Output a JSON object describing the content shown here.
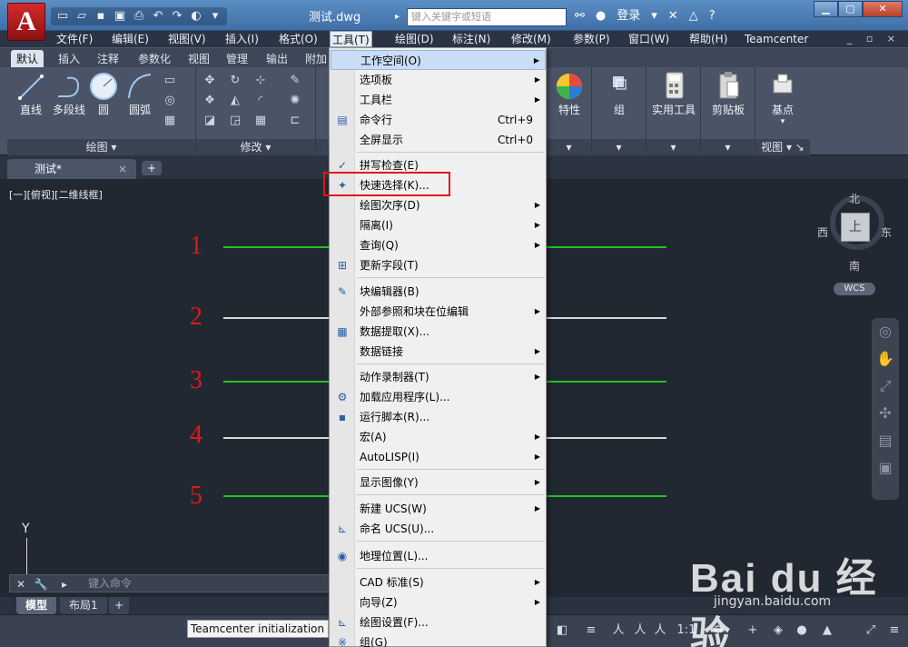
{
  "titlebar": {
    "app_logo": "A",
    "doc_title": "测试.dwg",
    "search_placeholder": "键入关键字或短语",
    "login": "登录",
    "help": "?"
  },
  "menubar": {
    "items": [
      "文件(F)",
      "编辑(E)",
      "视图(V)",
      "插入(I)",
      "格式(O)",
      "工具(T)",
      "绘图(D)",
      "标注(N)",
      "修改(M)",
      "参数(P)",
      "窗口(W)",
      "帮助(H)",
      "Teamcenter"
    ],
    "active": "工具(T)"
  },
  "ribbon": {
    "tabs": [
      "默认",
      "插入",
      "注释",
      "参数化",
      "视图",
      "管理",
      "输出",
      "附加"
    ],
    "groups": {
      "draw": {
        "title": "绘图",
        "tools": [
          "直线",
          "多段线",
          "圆",
          "圆弧"
        ]
      },
      "modify": {
        "title": "修改"
      },
      "properties": {
        "tool": "特性"
      },
      "group": {
        "tool": "组"
      },
      "utilities": {
        "tool": "实用工具"
      },
      "clipboard": {
        "tool": "剪贴板"
      },
      "view": {
        "title": "视图",
        "tool": "基点"
      }
    }
  },
  "filetab": {
    "label": "测试*",
    "close": "×",
    "add": "+"
  },
  "canvas": {
    "view_label": "[一][俯视][二维线框]",
    "line_numbers": [
      "1",
      "2",
      "3",
      "4",
      "5"
    ],
    "line_colors": [
      "#22c322",
      "#d8d8d8",
      "#22c322",
      "#d8d8d8",
      "#22c322"
    ],
    "compass": {
      "north": "北",
      "south": "南",
      "east": "东",
      "west": "西",
      "cube_face": "上"
    },
    "wcs": "WCS",
    "ucs_axis": "Y"
  },
  "command": {
    "placeholder": "键入命令"
  },
  "layout_tabs": [
    "模型",
    "布局1",
    "+"
  ],
  "status": {
    "message": "Teamcenter initialization is do",
    "scale": "1:1"
  },
  "dropdown": {
    "items": [
      {
        "label": "工作空间(O)",
        "submenu": true,
        "highlight": true
      },
      {
        "label": "选项板",
        "submenu": true
      },
      {
        "label": "工具栏",
        "submenu": true
      },
      {
        "label": "命令行",
        "shortcut": "Ctrl+9",
        "icon": "command-line-icon"
      },
      {
        "label": "全屏显示",
        "shortcut": "Ctrl+0"
      },
      {
        "label": "拼写检查(E)",
        "icon": "spell-check-icon"
      },
      {
        "label": "快速选择(K)...",
        "icon": "quick-select-icon"
      },
      {
        "label": "绘图次序(D)",
        "submenu": true
      },
      {
        "label": "隔离(I)",
        "submenu": true
      },
      {
        "label": "查询(Q)",
        "submenu": true
      },
      {
        "label": "更新字段(T)",
        "icon": "update-field-icon"
      },
      {
        "label": "块编辑器(B)",
        "icon": "block-editor-icon"
      },
      {
        "label": "外部参照和块在位编辑",
        "submenu": true
      },
      {
        "label": "数据提取(X)...",
        "icon": "data-extraction-icon"
      },
      {
        "label": "数据链接",
        "submenu": true
      },
      {
        "label": "动作录制器(T)",
        "submenu": true
      },
      {
        "label": "加载应用程序(L)...",
        "icon": "load-app-icon"
      },
      {
        "label": "运行脚本(R)...",
        "icon": "run-script-icon"
      },
      {
        "label": "宏(A)",
        "submenu": true
      },
      {
        "label": "AutoLISP(I)",
        "submenu": true
      },
      {
        "label": "显示图像(Y)",
        "submenu": true
      },
      {
        "label": "新建 UCS(W)",
        "submenu": true
      },
      {
        "label": "命名 UCS(U)...",
        "icon": "named-ucs-icon"
      },
      {
        "label": "地理位置(L)...",
        "icon": "geolocation-icon"
      },
      {
        "label": "CAD 标准(S)",
        "submenu": true
      },
      {
        "label": "向导(Z)",
        "submenu": true
      },
      {
        "label": "绘图设置(F)...",
        "icon": "drafting-settings-icon"
      },
      {
        "label": "组(G)",
        "icon": "group-icon"
      }
    ]
  },
  "watermark": {
    "logo": "Bai du 经验",
    "url": "jingyan.baidu.com"
  }
}
